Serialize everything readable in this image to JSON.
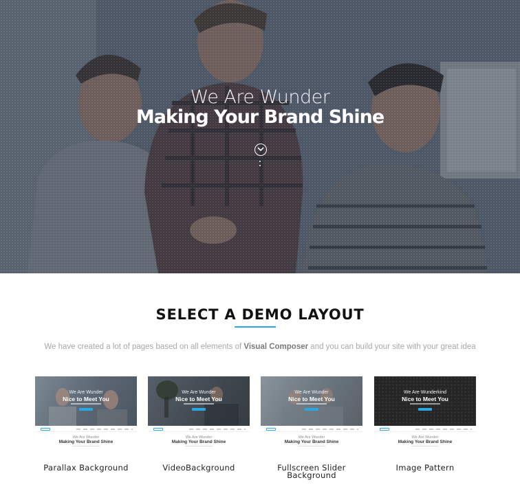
{
  "hero": {
    "line1": "We Are Wunder",
    "line2": "Making Your Brand Shine",
    "scroll_icon": "chevron-down-circle-icon"
  },
  "section": {
    "title": "SELECT A DEMO LAYOUT",
    "subtitle_before": "We have created a lot of pages based on all elements of ",
    "subtitle_bold": "Visual Composer",
    "subtitle_after": " and you can build your site with your great idea",
    "accent_color": "#2aa7e0"
  },
  "demos": [
    {
      "label": "Parallax Background",
      "preview_line1": "We Are Wunder",
      "preview_line2": "Nice to Meet You",
      "preview_lower1": "We Are Wunder",
      "preview_lower2": "Making Your Brand Shine"
    },
    {
      "label": "VideoBackground",
      "preview_line1": "We Are Wunder",
      "preview_line2": "Nice to Meet You",
      "preview_lower1": "We Are Wunder",
      "preview_lower2": "Making Your Brand Shine"
    },
    {
      "label_line1": "Fullscreen Slider",
      "label_line2": "Background",
      "preview_line1": "We Are Wunder",
      "preview_line2": "Nice to Meet You",
      "preview_lower1": "We Are Wunder",
      "preview_lower2": "Making Your Brand Shine"
    },
    {
      "label": "Image Pattern",
      "preview_line1": "We Are Wunderkind",
      "preview_line2": "Nice to Meet You",
      "preview_lower1": "We Are Wunder",
      "preview_lower2": "Making Your Brand Shine"
    }
  ]
}
